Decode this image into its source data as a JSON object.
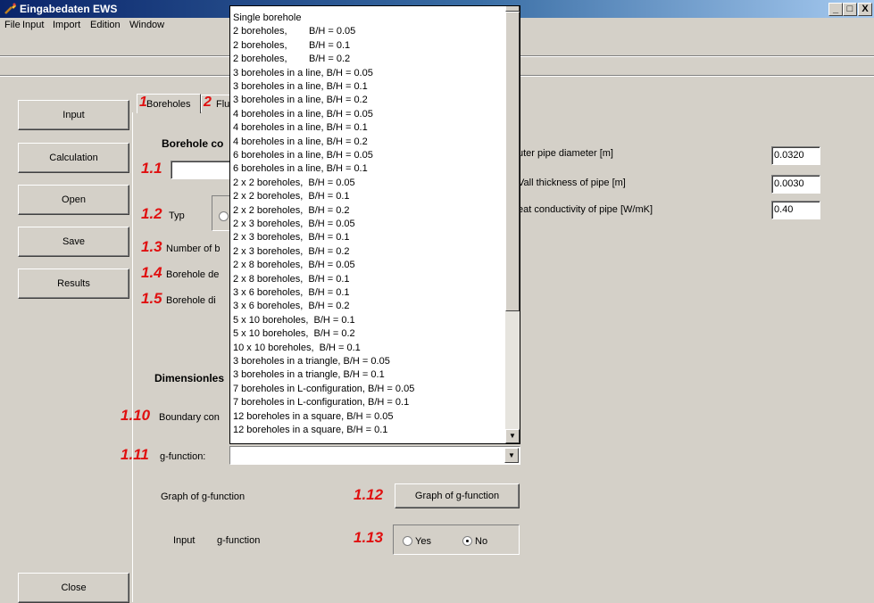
{
  "window": {
    "title": "Eingabedaten EWS",
    "minimize": "_",
    "maximize": "□",
    "close": "X"
  },
  "menu": [
    "File",
    "Input",
    "Import",
    "Edition",
    "Window"
  ],
  "sidebar": {
    "input": "Input",
    "calculation": "Calculation",
    "open": "Open",
    "save": "Save",
    "results": "Results",
    "close": "Close"
  },
  "tabs": {
    "boreholes_num": "1",
    "boreholes": "Boreholes",
    "fluid_num": "2",
    "fluid": "Flu"
  },
  "section": {
    "borehole_config": "Borehole co",
    "dimensionless": "Dimensionles"
  },
  "fields": {
    "n1_1": "1.1",
    "n1_2": "1.2",
    "typ": "Typ",
    "n1_3": "1.3",
    "number_label": "Number of b",
    "n1_4": "1.4",
    "depth_label": "Borehole de",
    "n1_5": "1.5",
    "diameter_label": "Borehole di",
    "n1_10": "1.10",
    "boundary_label": "Boundary con",
    "n1_11": "1.11",
    "gfunction_label": "g-function:",
    "graph_label": "Graph of g-function",
    "n1_12": "1.12",
    "graph_button": "Graph of g-function",
    "input_label": "Input",
    "input_gfunction_label": "g-function",
    "n1_13": "1.13",
    "yes": "Yes",
    "no": "No",
    "no_selected": true
  },
  "pipe": {
    "outer_label": "uter pipe diameter [m]",
    "outer_value": "0.0320",
    "wall_label": "Vall thickness of pipe [m]",
    "wall_value": "0.0030",
    "conductivity_label": "eat conductivity of pipe [W/mK]",
    "conductivity_value": "0.40"
  },
  "dropdown_options": [
    "Single borehole",
    "2 boreholes,        B/H = 0.05",
    "2 boreholes,        B/H = 0.1",
    "2 boreholes,        B/H = 0.2",
    "3 boreholes in a line, B/H = 0.05",
    "3 boreholes in a line, B/H = 0.1",
    "3 boreholes in a line, B/H = 0.2",
    "4 boreholes in a line, B/H = 0.05",
    "4 boreholes in a line, B/H = 0.1",
    "4 boreholes in a line, B/H = 0.2",
    "6 boreholes in a line, B/H = 0.05",
    "6 boreholes in a line, B/H = 0.1",
    "2 x 2 boreholes,  B/H = 0.05",
    "2 x 2 boreholes,  B/H = 0.1",
    "2 x 2 boreholes,  B/H = 0.2",
    "2 x 3 boreholes,  B/H = 0.05",
    "2 x 3 boreholes,  B/H = 0.1",
    "2 x 3 boreholes,  B/H = 0.2",
    "2 x 8 boreholes,  B/H = 0.05",
    "2 x 8 boreholes,  B/H = 0.1",
    "3 x 6 boreholes,  B/H = 0.1",
    "3 x 6 boreholes,  B/H = 0.2",
    "5 x 10 boreholes,  B/H = 0.1",
    "5 x 10 boreholes,  B/H = 0.2",
    "10 x 10 boreholes,  B/H = 0.1",
    "3 boreholes in a triangle, B/H = 0.05",
    "3 boreholes in a triangle, B/H = 0.1",
    "7 boreholes in L-configuration, B/H = 0.05",
    "7 boreholes in L-configuration, B/H = 0.1",
    "12 boreholes in a square, B/H = 0.05",
    "12 boreholes in a square, B/H = 0.1"
  ],
  "scroll_position": 0,
  "icons": {
    "app": "tool-icon",
    "arrow_up": "▲",
    "arrow_down": "▼"
  }
}
